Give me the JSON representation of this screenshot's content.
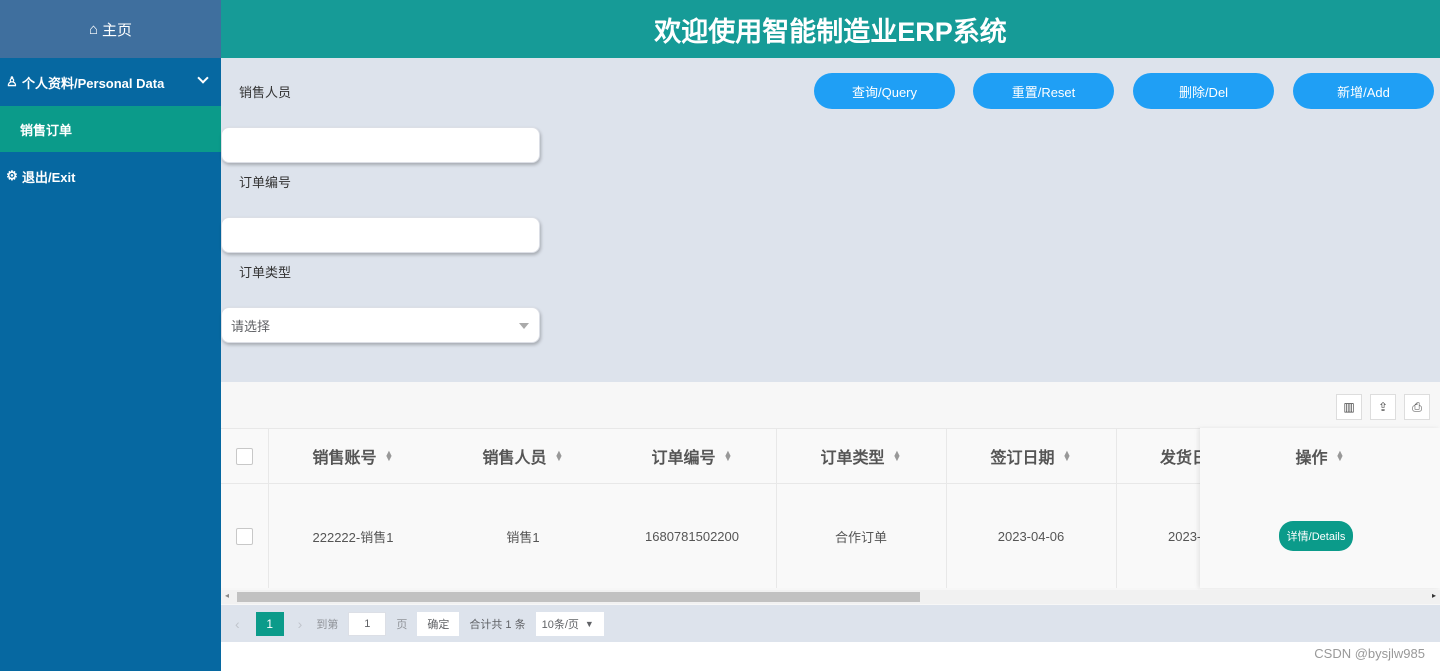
{
  "sidebar": {
    "home": "主页",
    "menu_personal": "个人资料/Personal Data",
    "sub_sales_order": "销售订单",
    "menu_exit": "退出/Exit"
  },
  "header": {
    "title": "欢迎使用智能制造业ERP系统"
  },
  "search": {
    "sales_person_label": "销售人员",
    "order_no_label": "订单编号",
    "order_type_label": "订单类型",
    "order_type_placeholder": "请选择",
    "buttons": {
      "query": "查询/Query",
      "reset": "重置/Reset",
      "delete": "删除/Del",
      "add": "新增/Add"
    }
  },
  "table": {
    "columns": [
      "销售账号",
      "销售人员",
      "订单编号",
      "订单类型",
      "签订日期",
      "发货日",
      "操作"
    ],
    "rows": [
      {
        "account": "222222-销售1",
        "person": "销售1",
        "order_no": "1680781502200",
        "type": "合作订单",
        "date": "2023-04-06",
        "ship": "2023-",
        "action": "详情/Details"
      }
    ]
  },
  "pager": {
    "current_page": "1",
    "goto_prefix": "到第",
    "goto_value": "1",
    "goto_suffix": "页",
    "confirm": "确定",
    "total": "合计共 1 条",
    "page_size": "10条/页"
  },
  "watermark": "CSDN @bysjlw985"
}
